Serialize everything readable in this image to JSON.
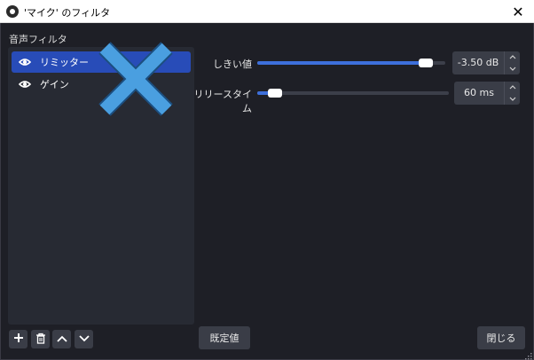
{
  "window": {
    "title": "'マイク' のフィルタ",
    "close_glyph": "✕"
  },
  "filters": {
    "section_label": "音声フィルタ",
    "items": [
      {
        "label": "リミッター",
        "selected": true,
        "icon": "eye-icon"
      },
      {
        "label": "ゲイン",
        "selected": false,
        "icon": "eye-icon"
      }
    ]
  },
  "properties": {
    "threshold": {
      "label": "しきい値",
      "value": "-3.50 dB",
      "level": 0.93
    },
    "release": {
      "label": "リリースタイム",
      "value": "60 ms",
      "level": 0.06
    }
  },
  "toolbar": {
    "add_icon": "plus-icon",
    "remove_icon": "trash-icon",
    "move_up_icon": "chevron-up-icon",
    "move_down_icon": "chevron-down-icon"
  },
  "buttons": {
    "defaults_label": "既定値",
    "close_label": "閉じる"
  },
  "colors": {
    "accent": "#284cb8",
    "slider_fill": "#3d6fdb",
    "overlay_x": "#4a9fe0"
  }
}
